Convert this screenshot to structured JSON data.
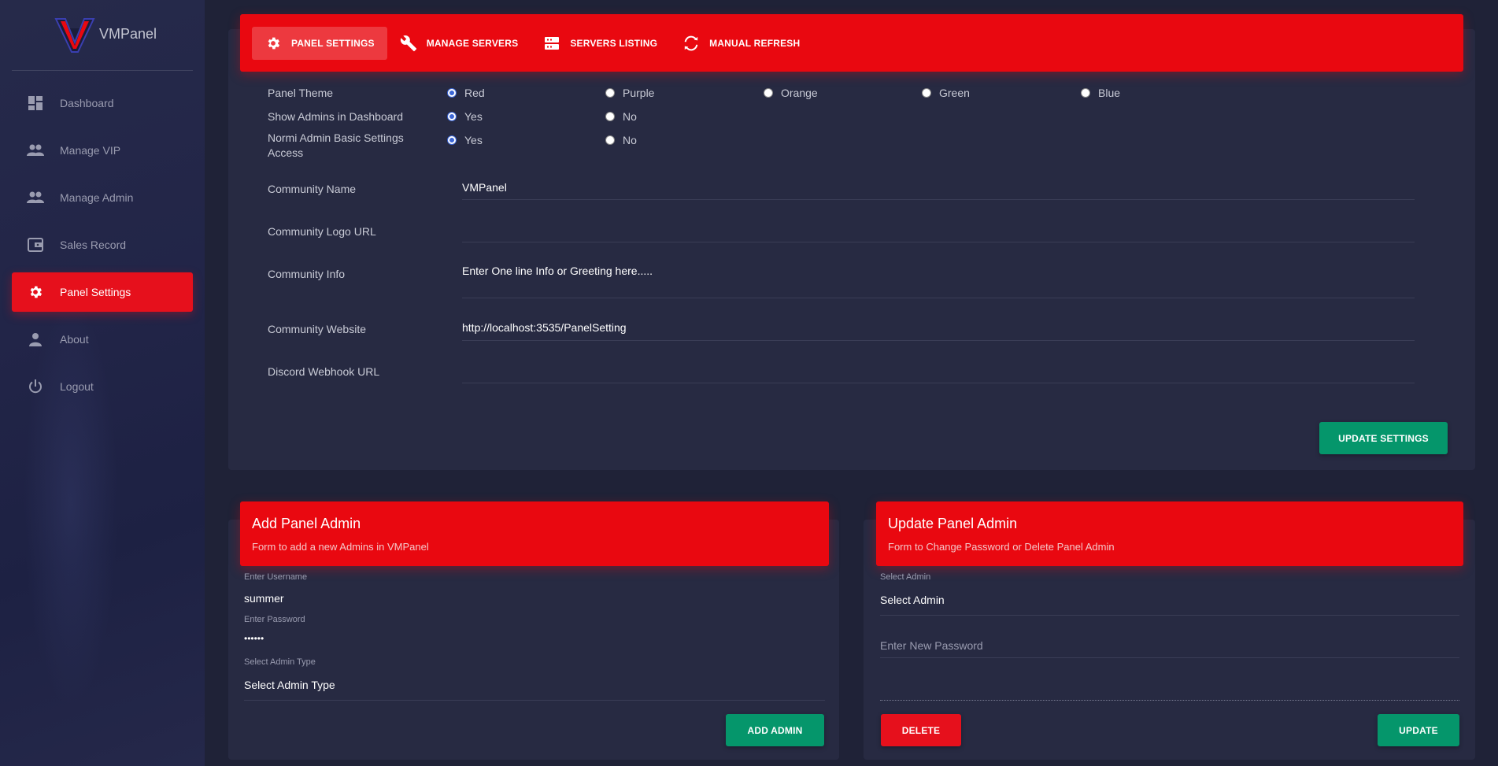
{
  "brand": {
    "name": "VMPanel",
    "logo_icon": "vm-logo-icon"
  },
  "sidebar": {
    "items": [
      {
        "label": "Dashboard",
        "icon": "dashboard-icon",
        "active": false
      },
      {
        "label": "Manage VIP",
        "icon": "people-icon",
        "active": false
      },
      {
        "label": "Manage Admin",
        "icon": "people-icon",
        "active": false
      },
      {
        "label": "Sales Record",
        "icon": "wallet-icon",
        "active": false
      },
      {
        "label": "Panel Settings",
        "icon": "gear-icon",
        "active": true
      },
      {
        "label": "About",
        "icon": "person-icon",
        "active": false
      },
      {
        "label": "Logout",
        "icon": "power-icon",
        "active": false
      }
    ]
  },
  "tabs": [
    {
      "label": "PANEL SETTINGS",
      "icon": "gear-icon",
      "active": true
    },
    {
      "label": "MANAGE SERVERS",
      "icon": "wrench-icon",
      "active": false
    },
    {
      "label": "SERVERS LISTING",
      "icon": "server-icon",
      "active": false
    },
    {
      "label": "MANUAL REFRESH",
      "icon": "refresh-icon",
      "active": false
    }
  ],
  "settings": {
    "theme": {
      "label": "Panel Theme",
      "options": [
        "Red",
        "Purple",
        "Orange",
        "Green",
        "Blue"
      ],
      "selected": "Red"
    },
    "show_admins": {
      "label": "Show Admins in Dashboard",
      "options": [
        "Yes",
        "No"
      ],
      "selected": "Yes"
    },
    "normi_access": {
      "label": "Normi Admin Basic Settings Access",
      "options": [
        "Yes",
        "No"
      ],
      "selected": "Yes"
    },
    "community_name": {
      "label": "Community Name",
      "value": "VMPanel"
    },
    "community_logo": {
      "label": "Community Logo URL",
      "value": ""
    },
    "community_info": {
      "label": "Community Info",
      "value": "Enter One line Info or Greeting here....."
    },
    "community_website": {
      "label": "Community Website",
      "value": "http://localhost:3535/PanelSetting"
    },
    "discord_webhook": {
      "label": "Discord Webhook URL",
      "value": ""
    },
    "update_button": "UPDATE SETTINGS"
  },
  "add_admin": {
    "title": "Add Panel Admin",
    "subtitle": "Form to add a new Admins in VMPanel",
    "username_label": "Enter Username",
    "username_value": "summer",
    "password_label": "Enter Password",
    "password_value": "••••••",
    "type_label": "Select Admin Type",
    "type_value": "Select Admin Type",
    "button": "ADD ADMIN"
  },
  "update_admin": {
    "title": "Update Panel Admin",
    "subtitle": "Form to Change Password or Delete Panel Admin",
    "select_label": "Select Admin",
    "select_value": "Select Admin",
    "password_placeholder": "Enter New Password",
    "delete_button": "DELETE",
    "update_button": "UPDATE"
  },
  "colors": {
    "accent": "#e90810",
    "success": "#05966b",
    "background": "#1f2237",
    "card": "#272a42"
  }
}
